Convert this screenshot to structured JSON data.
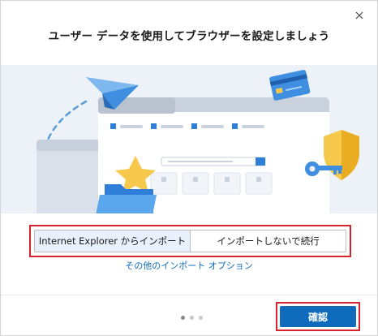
{
  "dialog": {
    "title": "ユーザー データを使用してブラウザーを設定しましょう",
    "close_icon": "close-icon"
  },
  "illustration": {
    "icons": [
      "paper-plane-icon",
      "browser-window-icon",
      "credit-card-icon",
      "shield-icon",
      "key-icon",
      "star-icon",
      "folder-icon"
    ]
  },
  "import": {
    "options": [
      {
        "label": "Internet Explorer からインポート",
        "selected": true
      },
      {
        "label": "インポートしないで続行",
        "selected": false
      }
    ],
    "more_link": "その他のインポート オプション"
  },
  "footer": {
    "pages": 3,
    "current_page": 1,
    "confirm_label": "確認"
  },
  "colors": {
    "accent": "#0f6cbd",
    "highlight_border": "#d6212e",
    "selected_bg": "#e8f1fb",
    "illustration_bg": "#edf2f8"
  }
}
